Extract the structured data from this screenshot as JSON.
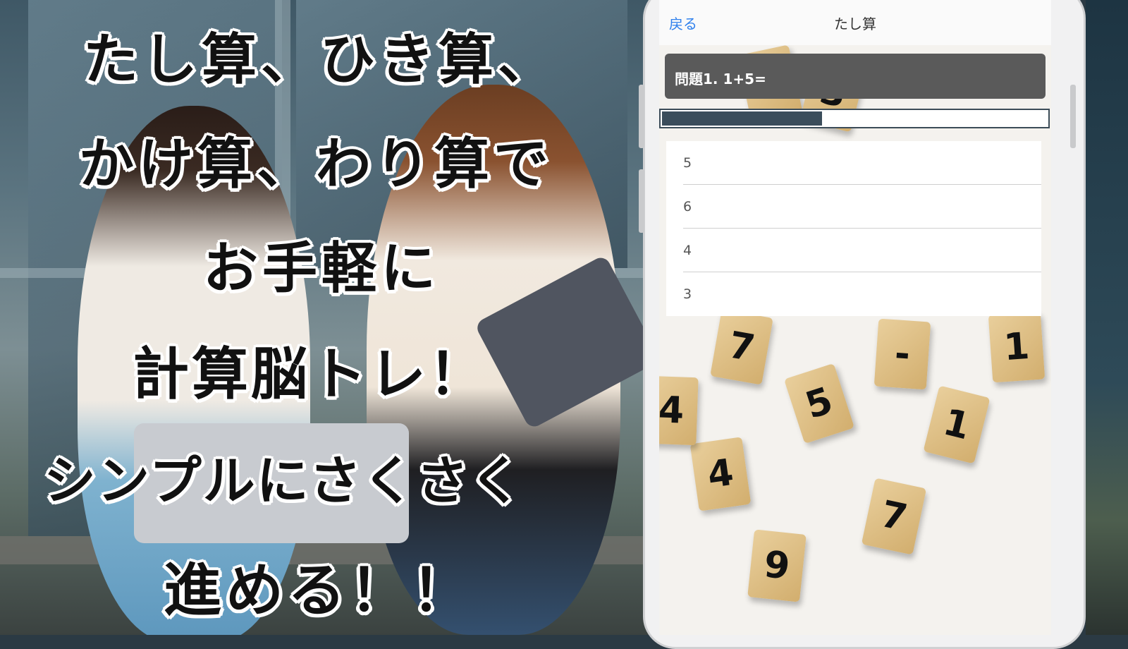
{
  "promo": {
    "lines": [
      "たし算、ひき算、",
      "かけ算、わり算で",
      "お手軽に",
      "計算脳トレ！",
      "シンプルにさくさく",
      "進める！！"
    ]
  },
  "app": {
    "back_label": "戻る",
    "title": "たし算",
    "question": "問題1. 1+5=",
    "progress": 0.42,
    "answers": [
      "5",
      "6",
      "4",
      "3"
    ]
  },
  "board_tiles": [
    "1",
    "3",
    "4",
    "5",
    "1",
    "7",
    "9",
    "1",
    "4",
    "-",
    "7"
  ],
  "colors": {
    "accent": "#2f80ed",
    "question_bar": "#5a5a5a",
    "progress_fill": "#3b4d5b"
  }
}
